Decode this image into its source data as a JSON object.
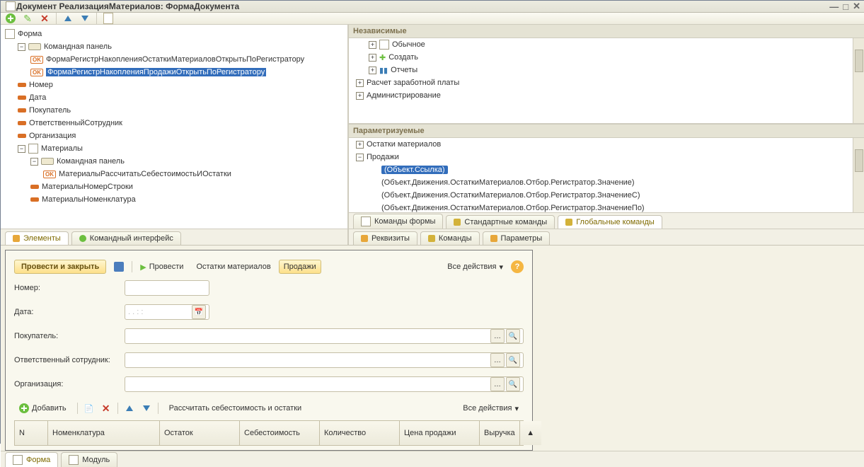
{
  "title": "Документ РеализацияМатериалов: ФормаДокумента",
  "tree": {
    "root": "Форма",
    "cmdpanel": "Командная панель",
    "item_ok1": "ФормаРегистрНакопленияОстаткиМатериаловОткрытьПоРегистратору",
    "item_ok2": "ФормаРегистрНакопленияПродажиОткрытьПоРегистратору",
    "nomer": "Номер",
    "data": "Дата",
    "pokup": "Покупатель",
    "otv": "ОтветственныйСотрудник",
    "org": "Организация",
    "materials": "Материалы",
    "cmdpanel2": "Командная панель",
    "mat_calc": "МатериалыРассчитатьСебестоимостьИОстатки",
    "mat_row": "МатериалыНомерСтроки",
    "mat_nom": "МатериалыНоменклатура"
  },
  "left_tabs": {
    "elements": "Элементы",
    "cmdiface": "Командный интерфейс"
  },
  "right": {
    "section1": "Независимые",
    "sec1_items": {
      "a": "Обычное",
      "b": "Создать",
      "c": "Отчеты",
      "d": "Расчет заработной платы",
      "e": "Администрирование"
    },
    "section2": "Параметризуемые",
    "sec2_items": {
      "a": "Остатки материалов",
      "b": "Продажи",
      "sel": "(Объект.Ссылка)",
      "c": "(Объект.Движения.ОстаткиМатериалов.Отбор.Регистратор.Значение)",
      "d": "(Объект.Движения.ОстаткиМатериалов.Отбор.Регистратор.ЗначениеС)",
      "e": "(Объект.Движения.ОстаткиМатериалов.Отбор.Регистратор.ЗначениеПо)"
    },
    "tabs_top": {
      "a": "Команды формы",
      "b": "Стандартные команды",
      "c": "Глобальные команды"
    },
    "tabs_bottom": {
      "a": "Реквизиты",
      "b": "Команды",
      "c": "Параметры"
    }
  },
  "preview": {
    "run_close": "Провести и закрыть",
    "provesti": "Провести",
    "ostatki": "Остатки материалов",
    "prodazhi": "Продажи",
    "all_actions": "Все действия",
    "nomer": "Номер:",
    "data": "Дата:",
    "date_hint": ". .   : :",
    "pokup": "Покупатель:",
    "otv": "Ответственный сотрудник:",
    "org": "Организация:",
    "add": "Добавить",
    "calc": "Рассчитать себестоимость и остатки",
    "cols": {
      "n": "N",
      "nom": "Номенклатура",
      "ost": "Остаток",
      "seb": "Себестоимость",
      "kol": "Количество",
      "cena": "Цена продажи",
      "vyr": "Выручка"
    }
  },
  "bottom_tabs": {
    "form": "Форма",
    "module": "Модуль"
  }
}
